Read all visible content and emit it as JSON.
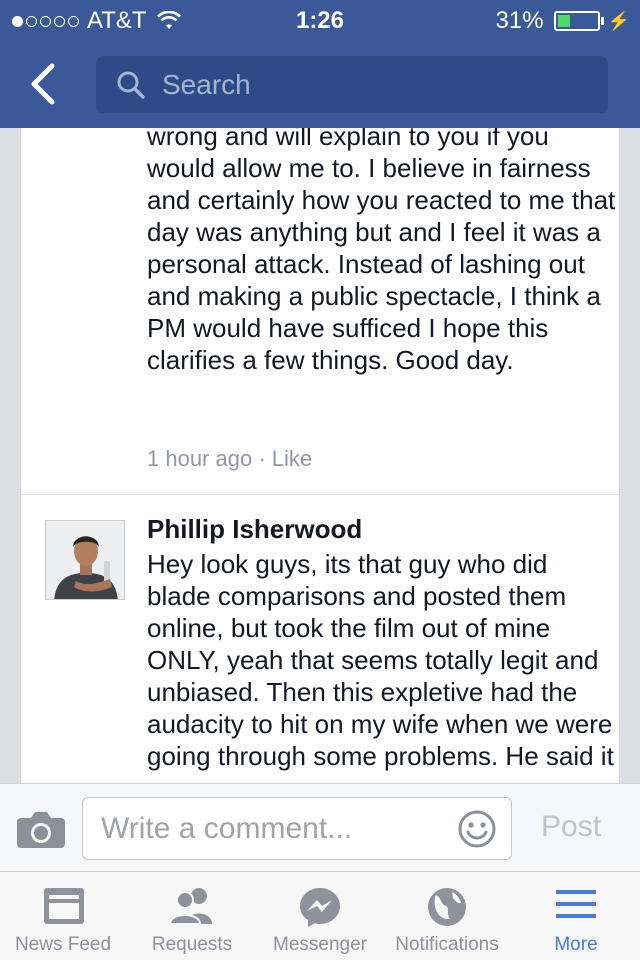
{
  "status_bar": {
    "carrier": "AT&T",
    "time": "1:26",
    "battery": "31%",
    "battery_level": 0.31
  },
  "nav": {
    "search_placeholder": "Search"
  },
  "comment_1": {
    "text": "wrong and will explain to you if you would allow me to. I believe in fairness and certainly how you reacted to me that day was anything but and I feel it was a personal attack. Instead of lashing out and making a public spectacle, I think a PM would have sufficed  I hope this clarifies a few things. Good day.",
    "time": "1 hour ago",
    "separator": "·",
    "like_label": "Like"
  },
  "comment_2": {
    "author": "Phillip Isherwood",
    "text": "Hey look guys, its that guy who did blade comparisons and posted them online, but took the film out of mine ONLY, yeah that seems totally legit and unbiased. Then this expletive had the audacity to hit on my wife when we were going through some problems. He said it"
  },
  "composer": {
    "placeholder": "Write a comment...",
    "post_label": "Post"
  },
  "tabs": [
    {
      "label": "News Feed",
      "icon": "news-feed-icon"
    },
    {
      "label": "Requests",
      "icon": "requests-icon"
    },
    {
      "label": "Messenger",
      "icon": "messenger-icon"
    },
    {
      "label": "Notifications",
      "icon": "globe-icon"
    },
    {
      "label": "More",
      "icon": "menu-icon",
      "active": true
    }
  ],
  "colors": {
    "brand": "#3b5998",
    "active_tab": "#4a7bd9",
    "battery": "#4cd964"
  }
}
